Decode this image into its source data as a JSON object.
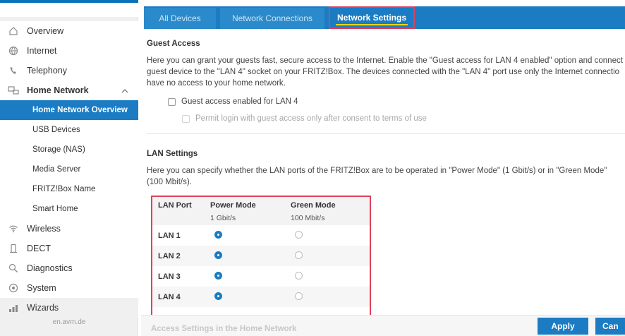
{
  "sidebar": {
    "items": [
      {
        "label": "Overview",
        "icon": "house-icon"
      },
      {
        "label": "Internet",
        "icon": "globe-icon"
      },
      {
        "label": "Telephony",
        "icon": "phone-icon"
      },
      {
        "label": "Home Network",
        "icon": "network-icon"
      }
    ],
    "sub_items": [
      {
        "label": "Home Network Overview",
        "active": true
      },
      {
        "label": "USB Devices"
      },
      {
        "label": "Storage (NAS)"
      },
      {
        "label": "Media Server"
      },
      {
        "label": "FRITZ!Box Name"
      },
      {
        "label": "Smart Home"
      }
    ],
    "lower_items": [
      {
        "label": "Wireless",
        "icon": "wifi-icon"
      },
      {
        "label": "DECT",
        "icon": "dect-phone-icon"
      },
      {
        "label": "Diagnostics",
        "icon": "magnifier-icon"
      },
      {
        "label": "System",
        "icon": "gear-icon"
      },
      {
        "label": "Wizards",
        "icon": "wizard-bars-icon"
      }
    ],
    "footer_url": "en.avm.de"
  },
  "tabs": [
    {
      "label": "All Devices"
    },
    {
      "label": "Network Connections"
    },
    {
      "label": "Network Settings",
      "active": true
    }
  ],
  "guest": {
    "heading": "Guest Access",
    "line1": "Here you can grant your guests fast, secure access to the Internet. Enable the \"Guest access for LAN 4 enabled\" option and connect",
    "line2": "guest device to the \"LAN 4\" socket on your FRITZ!Box. The devices connected with the \"LAN 4\" port use only the Internet connectio",
    "line3": "have no access to your home network.",
    "checkbox_label": "Guest access enabled for LAN 4",
    "sub_checkbox_label": "Permit login with guest access only after consent to terms of use"
  },
  "lan": {
    "heading": "LAN Settings",
    "line1": "Here you can specify whether the LAN ports of the FRITZ!Box are to be operated in \"Power Mode\" (1 Gbit/s) or in \"Green Mode\"",
    "line2": "(100 Mbit/s).",
    "table": {
      "col_port": "LAN Port",
      "col_power": "Power Mode",
      "col_power_sub": "1 Gbit/s",
      "col_green": "Green Mode",
      "col_green_sub": "100 Mbit/s",
      "rows": [
        {
          "port": "LAN 1",
          "mode": "power"
        },
        {
          "port": "LAN 2",
          "mode": "power"
        },
        {
          "port": "LAN 3",
          "mode": "power"
        },
        {
          "port": "LAN 4",
          "mode": "power"
        }
      ]
    }
  },
  "footer": {
    "faded_heading": "Access Settings in the Home Network",
    "apply_label": "Apply",
    "cancel_label": "Can"
  },
  "colors": {
    "accent": "#1b7cc3",
    "highlight_border": "#e0405b"
  }
}
